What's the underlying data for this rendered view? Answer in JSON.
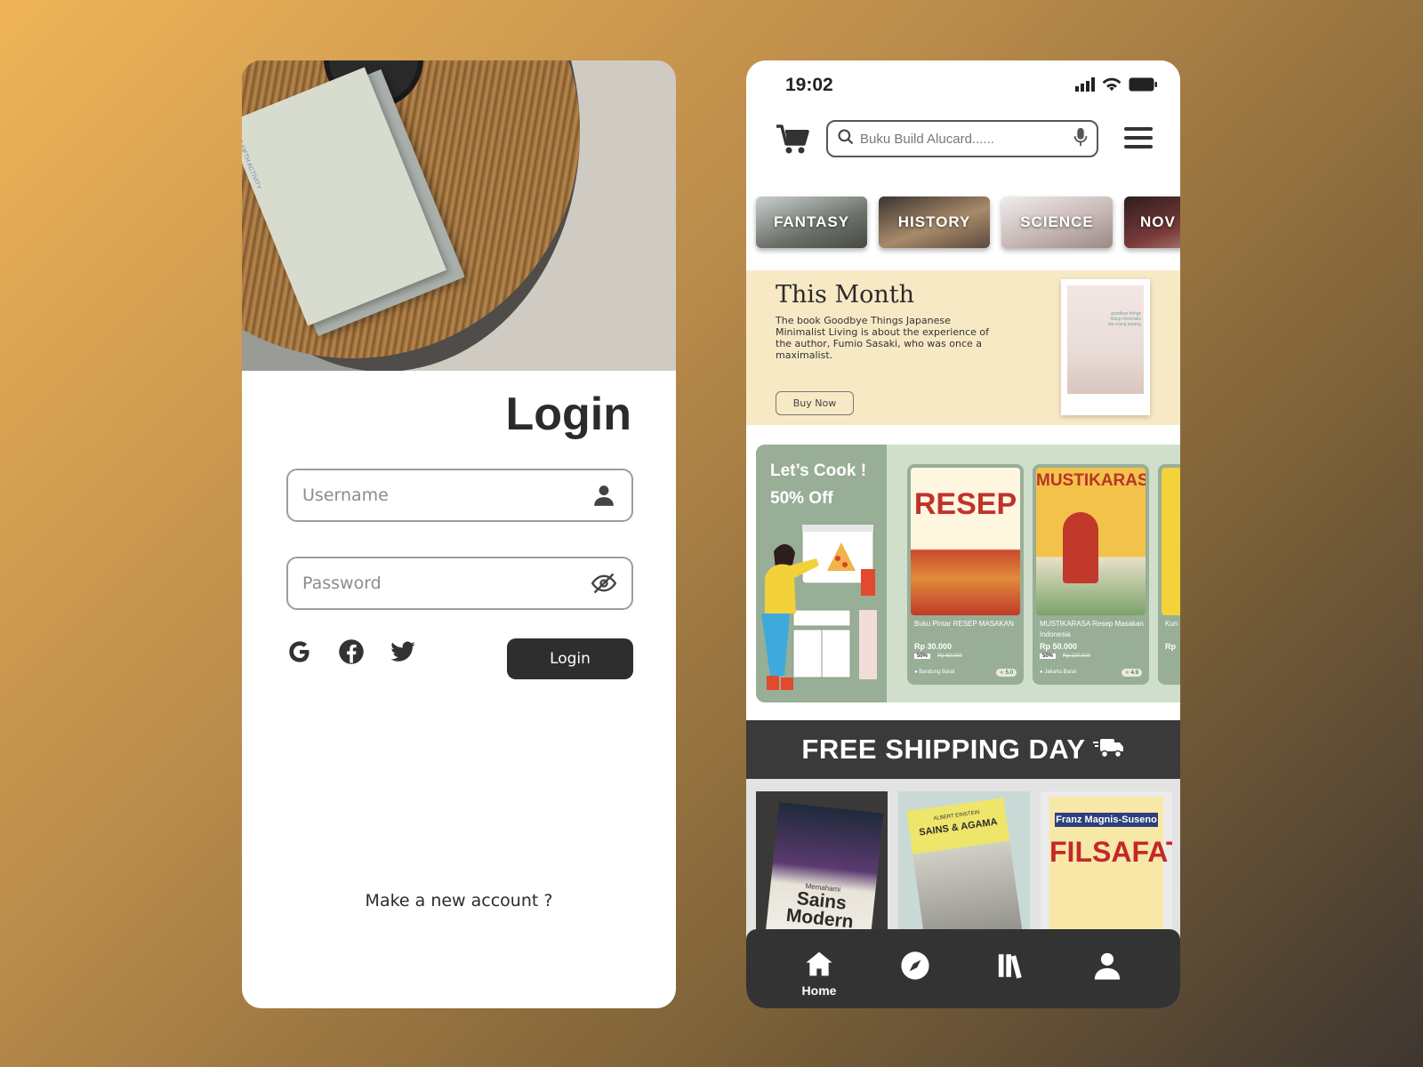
{
  "login": {
    "hero_book_title": "THE FIFTH ACTIVITY",
    "title": "Login",
    "username_placeholder": "Username",
    "password_placeholder": "Password",
    "social_icons": [
      "google-icon",
      "facebook-icon",
      "twitter-icon"
    ],
    "login_button": "Login",
    "new_account": "Make a new account ?"
  },
  "shop": {
    "status_time": "19:02",
    "search_placeholder": "Buku Build Alucard......",
    "categories": [
      {
        "label": "FANTASY"
      },
      {
        "label": "HISTORY"
      },
      {
        "label": "SCIENCE"
      },
      {
        "label": "NOV"
      }
    ],
    "this_month": {
      "title": "This Month",
      "description": "The book Goodbye Things Japanese Minimalist Living is about the experience of the author, Fumio Sasaki, who was once a maximalist.",
      "buy_button": "Buy Now",
      "cover_text": "goodbye things hidup minimalis ala orang jepang"
    },
    "promo": {
      "line1": "Let’s Cook !",
      "line2": "50% Off",
      "products": [
        {
          "cover_title": "RESEP",
          "name": "Buku Pintar RESEP MASAKAN",
          "price": "Rp 30.000",
          "discount": "50%",
          "old_price": "Rp 60.000",
          "location": "Bandung Barat",
          "rating": "5.0"
        },
        {
          "cover_title": "MUSTIKARASA",
          "name": "MUSTIKARASA Resep Masakan Indonesia",
          "price": "Rp 50.000",
          "discount": "50%",
          "old_price": "Rp 100.000",
          "location": "Jakarta Barat",
          "rating": "4.9"
        },
        {
          "cover_title": "",
          "name": "Kun Tra",
          "price": "Rp",
          "discount": "",
          "old_price": "",
          "location": "",
          "rating": ""
        }
      ]
    },
    "free_shipping": "FREE SHIPPING DAY",
    "shipping_books": [
      {
        "title": "Sains Modern",
        "subtitle": "Memahami"
      },
      {
        "title": "SAINS & AGAMA",
        "subtitle": "ALBERT EINSTEIN"
      },
      {
        "title": "FILSAFAT",
        "subtitle": "Franz Magnis-Suseno"
      }
    ],
    "nav": {
      "home_label": "Home"
    }
  },
  "colors": {
    "dark": "#2e2e2e",
    "month_bg": "#f8e9c5",
    "promo_green": "#98ae96",
    "promo_light": "#cfdfcb"
  }
}
